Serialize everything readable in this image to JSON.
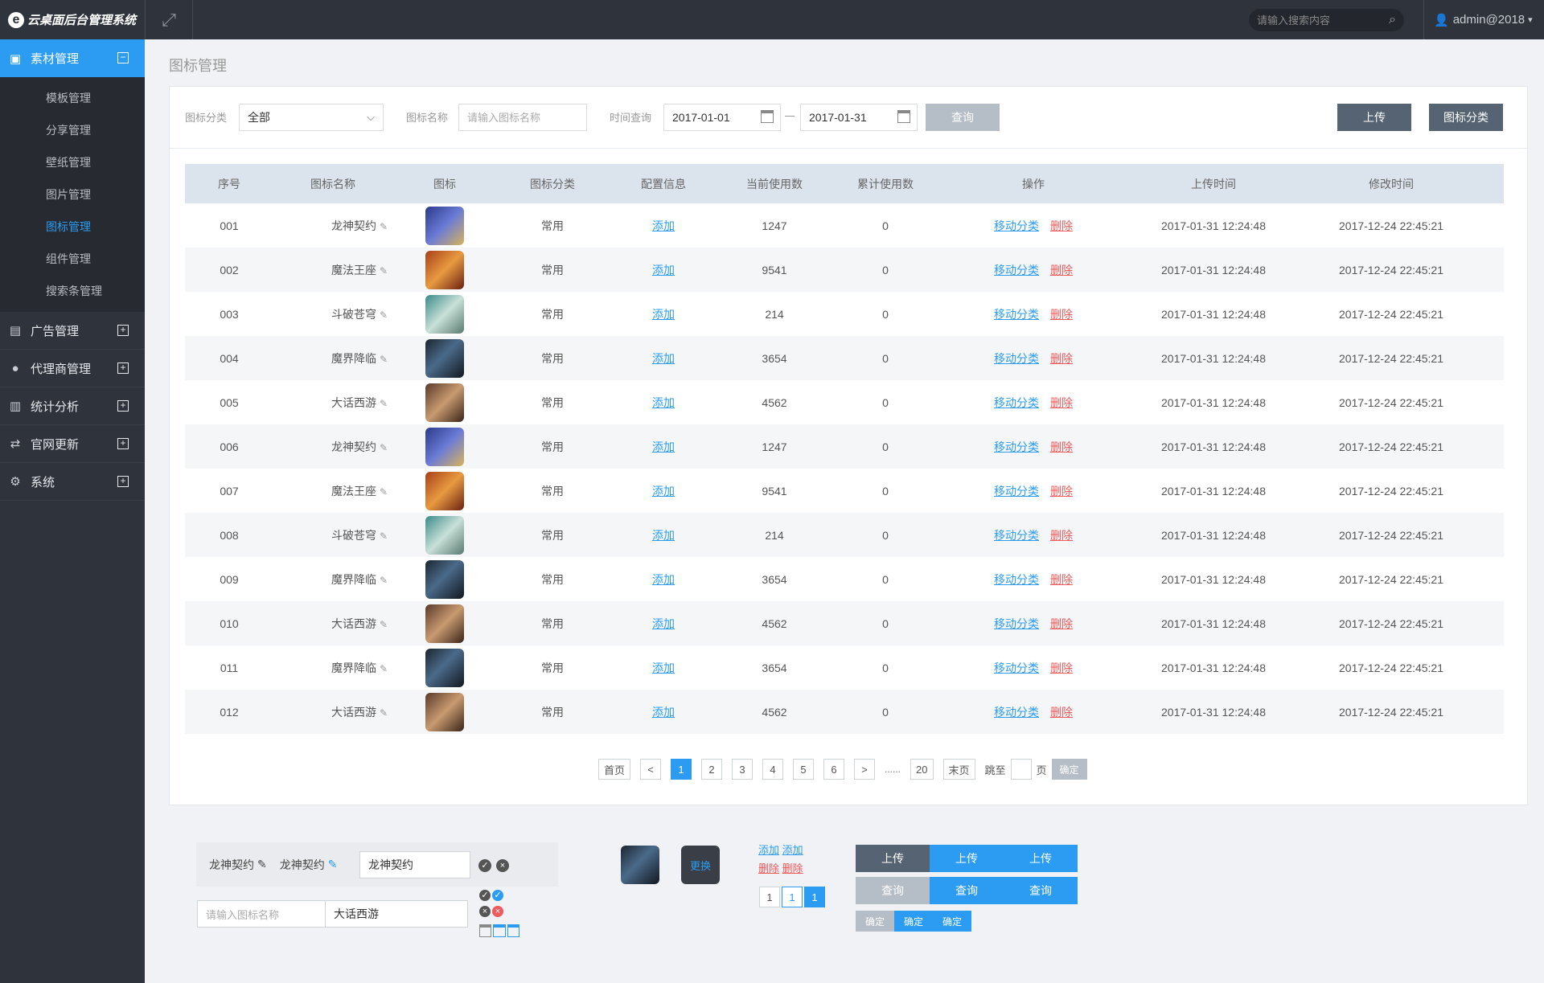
{
  "header": {
    "app_title": "云桌面后台管理系统",
    "search_placeholder": "请输入搜索内容",
    "user": "admin@2018"
  },
  "sidebar": {
    "groups": [
      {
        "label": "素材管理",
        "toggle": "−",
        "icon": "image-icon"
      },
      {
        "label": "广告管理",
        "toggle": "+",
        "icon": "ad-icon"
      },
      {
        "label": "代理商管理",
        "toggle": "+",
        "icon": "person-icon"
      },
      {
        "label": "统计分析",
        "toggle": "+",
        "icon": "bar-chart-icon"
      },
      {
        "label": "官网更新",
        "toggle": "+",
        "icon": "refresh-icon"
      },
      {
        "label": "系统",
        "toggle": "+",
        "icon": "gear-icon"
      }
    ],
    "subitems": [
      "模板管理",
      "分享管理",
      "壁纸管理",
      "图片管理",
      "图标管理",
      "组件管理",
      "搜索条管理"
    ]
  },
  "breadcrumb": "图标管理",
  "filter": {
    "category_label": "图标分类",
    "category_value": "全部",
    "name_label": "图标名称",
    "name_placeholder": "请输入图标名称",
    "time_label": "时间查询",
    "date_from": "2017-01-01",
    "date_to": "2017-01-31",
    "query_button": "查询",
    "upload_button": "上传",
    "category_button": "图标分类"
  },
  "table": {
    "headers": [
      "序号",
      "图标名称",
      "图标",
      "图标分类",
      "配置信息",
      "当前使用数",
      "累计使用数",
      "操作",
      "上传时间",
      "修改时间"
    ],
    "rows": [
      {
        "no": "001",
        "name": "龙神契约",
        "cat": "常用",
        "config": "添加",
        "current": "1247",
        "total": "0",
        "upload": "2017-01-31  12:24:48",
        "modify": "2017-12-24  22:45:21"
      },
      {
        "no": "002",
        "name": "魔法王座",
        "cat": "常用",
        "config": "添加",
        "current": "9541",
        "total": "0",
        "upload": "2017-01-31  12:24:48",
        "modify": "2017-12-24  22:45:21"
      },
      {
        "no": "003",
        "name": "斗破苍穹",
        "cat": "常用",
        "config": "添加",
        "current": "214",
        "total": "0",
        "upload": "2017-01-31  12:24:48",
        "modify": "2017-12-24  22:45:21"
      },
      {
        "no": "004",
        "name": "魔界降临",
        "cat": "常用",
        "config": "添加",
        "current": "3654",
        "total": "0",
        "upload": "2017-01-31  12:24:48",
        "modify": "2017-12-24  22:45:21"
      },
      {
        "no": "005",
        "name": "大话西游",
        "cat": "常用",
        "config": "添加",
        "current": "4562",
        "total": "0",
        "upload": "2017-01-31  12:24:48",
        "modify": "2017-12-24  22:45:21"
      },
      {
        "no": "006",
        "name": "龙神契约",
        "cat": "常用",
        "config": "添加",
        "current": "1247",
        "total": "0",
        "upload": "2017-01-31  12:24:48",
        "modify": "2017-12-24  22:45:21"
      },
      {
        "no": "007",
        "name": "魔法王座",
        "cat": "常用",
        "config": "添加",
        "current": "9541",
        "total": "0",
        "upload": "2017-01-31  12:24:48",
        "modify": "2017-12-24  22:45:21"
      },
      {
        "no": "008",
        "name": "斗破苍穹",
        "cat": "常用",
        "config": "添加",
        "current": "214",
        "total": "0",
        "upload": "2017-01-31  12:24:48",
        "modify": "2017-12-24  22:45:21"
      },
      {
        "no": "009",
        "name": "魔界降临",
        "cat": "常用",
        "config": "添加",
        "current": "3654",
        "total": "0",
        "upload": "2017-01-31  12:24:48",
        "modify": "2017-12-24  22:45:21"
      },
      {
        "no": "010",
        "name": "大话西游",
        "cat": "常用",
        "config": "添加",
        "current": "4562",
        "total": "0",
        "upload": "2017-01-31  12:24:48",
        "modify": "2017-12-24  22:45:21"
      },
      {
        "no": "011",
        "name": "魔界降临",
        "cat": "常用",
        "config": "添加",
        "current": "3654",
        "total": "0",
        "upload": "2017-01-31  12:24:48",
        "modify": "2017-12-24  22:45:21"
      },
      {
        "no": "012",
        "name": "大话西游",
        "cat": "常用",
        "config": "添加",
        "current": "4562",
        "total": "0",
        "upload": "2017-01-31  12:24:48",
        "modify": "2017-12-24  22:45:21"
      }
    ],
    "op_move": "移动分类",
    "op_delete": "删除"
  },
  "pager": {
    "first": "首页",
    "prev": "<",
    "pages": [
      "1",
      "2",
      "3",
      "4",
      "5",
      "6"
    ],
    "next": ">",
    "ellipsis": "......",
    "last_page": "20",
    "last": "末页",
    "goto": "跳至",
    "page_unit": "页",
    "confirm": "确定"
  },
  "demo": {
    "name1": "龙神契约",
    "name2": "龙神契约",
    "edit_value": "龙神契约",
    "name_placeholder": "请输入图标名称",
    "name_value": "大话西游",
    "replace": "更换",
    "add": "添加",
    "delete": "删除",
    "mini_pages": [
      "1",
      "1",
      "1"
    ],
    "upload": "上传",
    "query": "查询",
    "confirm": "确定"
  },
  "colors": {
    "accent": "#2b9cf2",
    "dark": "#2f343c",
    "danger": "#f05a5a",
    "slate": "#556372"
  }
}
